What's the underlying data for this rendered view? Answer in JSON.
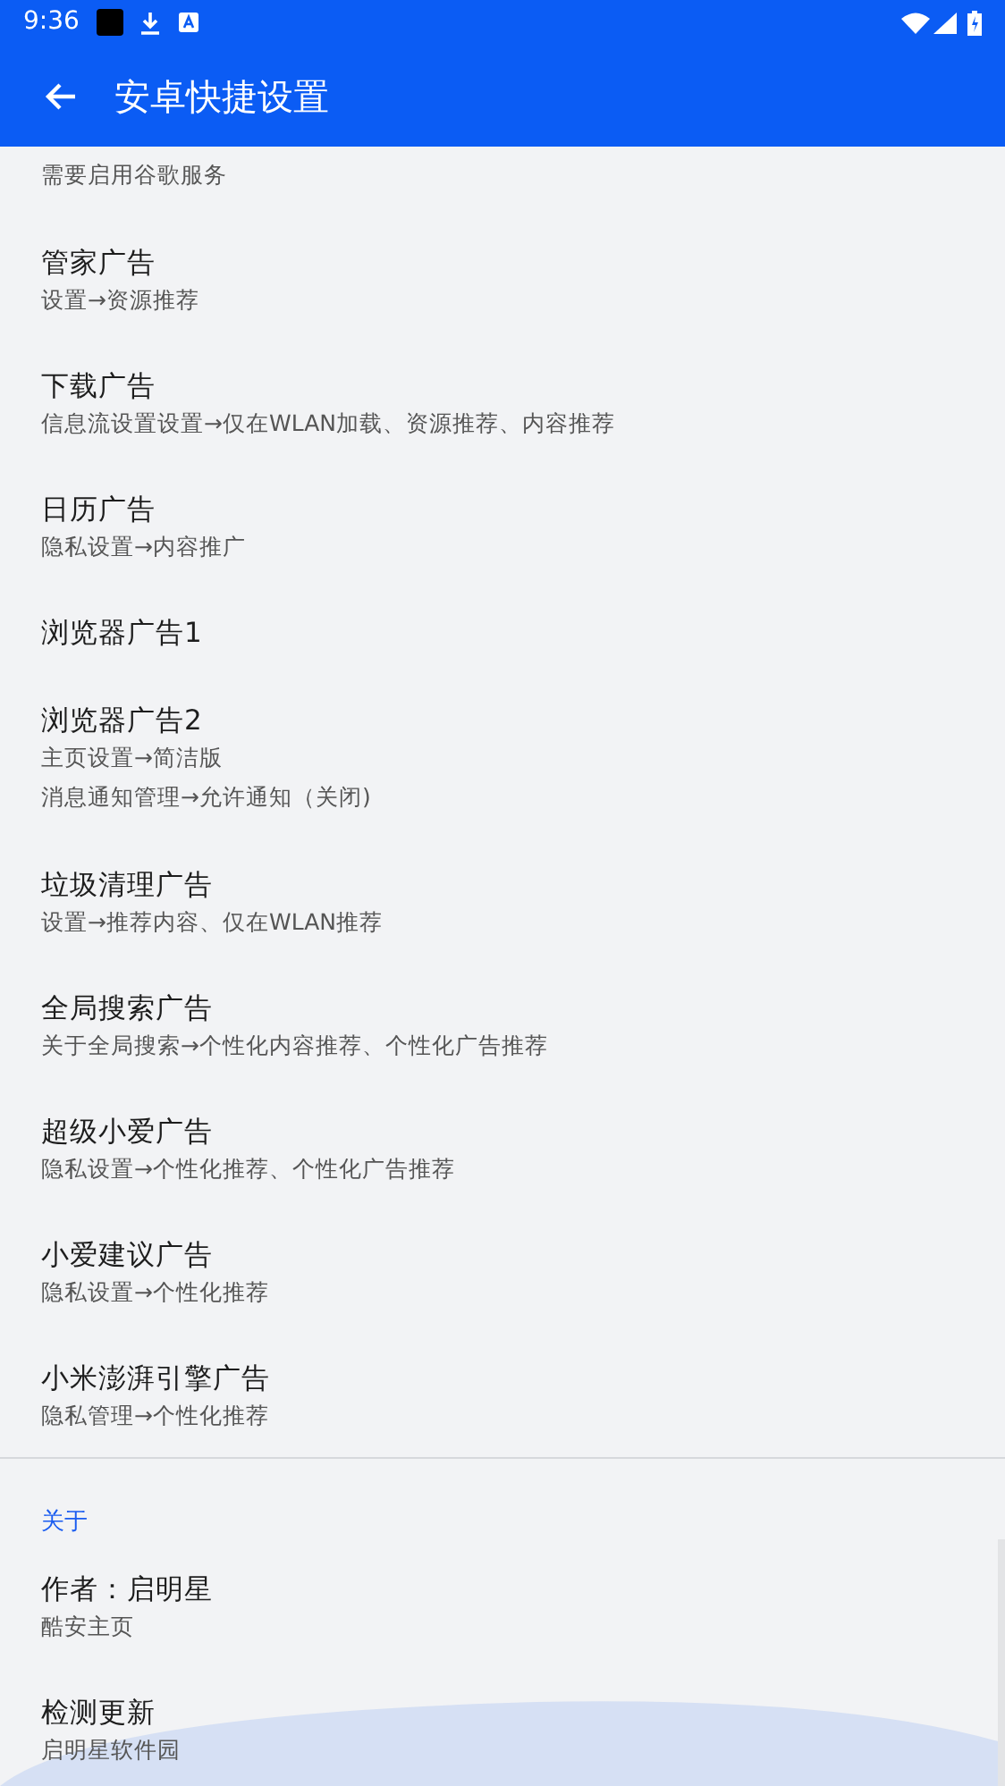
{
  "status_bar": {
    "time": "9:36"
  },
  "app_bar": {
    "title": "安卓快捷设置"
  },
  "items": [
    {
      "subtitles": [
        "需要启用谷歌服务"
      ]
    },
    {
      "title": "管家广告",
      "subtitles": [
        "设置→资源推荐"
      ]
    },
    {
      "title": "下载广告",
      "subtitles": [
        "信息流设置设置→仅在WLAN加载、资源推荐、内容推荐"
      ]
    },
    {
      "title": "日历广告",
      "subtitles": [
        "隐私设置→内容推广"
      ]
    },
    {
      "title": "浏览器广告1"
    },
    {
      "title": "浏览器广告2",
      "subtitles": [
        "主页设置→简洁版",
        "消息通知管理→允许通知（关闭)"
      ]
    },
    {
      "title": "垃圾清理广告",
      "subtitles": [
        "设置→推荐内容、仅在WLAN推荐"
      ]
    },
    {
      "title": "全局搜索广告",
      "subtitles": [
        "关于全局搜索→个性化内容推荐、个性化广告推荐"
      ]
    },
    {
      "title": "超级小爱广告",
      "subtitles": [
        "隐私设置→个性化推荐、个性化广告推荐"
      ]
    },
    {
      "title": "小爱建议广告",
      "subtitles": [
        "隐私设置→个性化推荐"
      ]
    },
    {
      "title": "小米澎湃引擎广告",
      "subtitles": [
        "隐私管理→个性化推荐"
      ]
    }
  ],
  "about": {
    "header": "关于",
    "items": [
      {
        "title": "作者：启明星",
        "subtitles": [
          "酷安主页"
        ]
      },
      {
        "title": "检测更新",
        "subtitles": [
          "启明星软件园"
        ]
      }
    ]
  }
}
